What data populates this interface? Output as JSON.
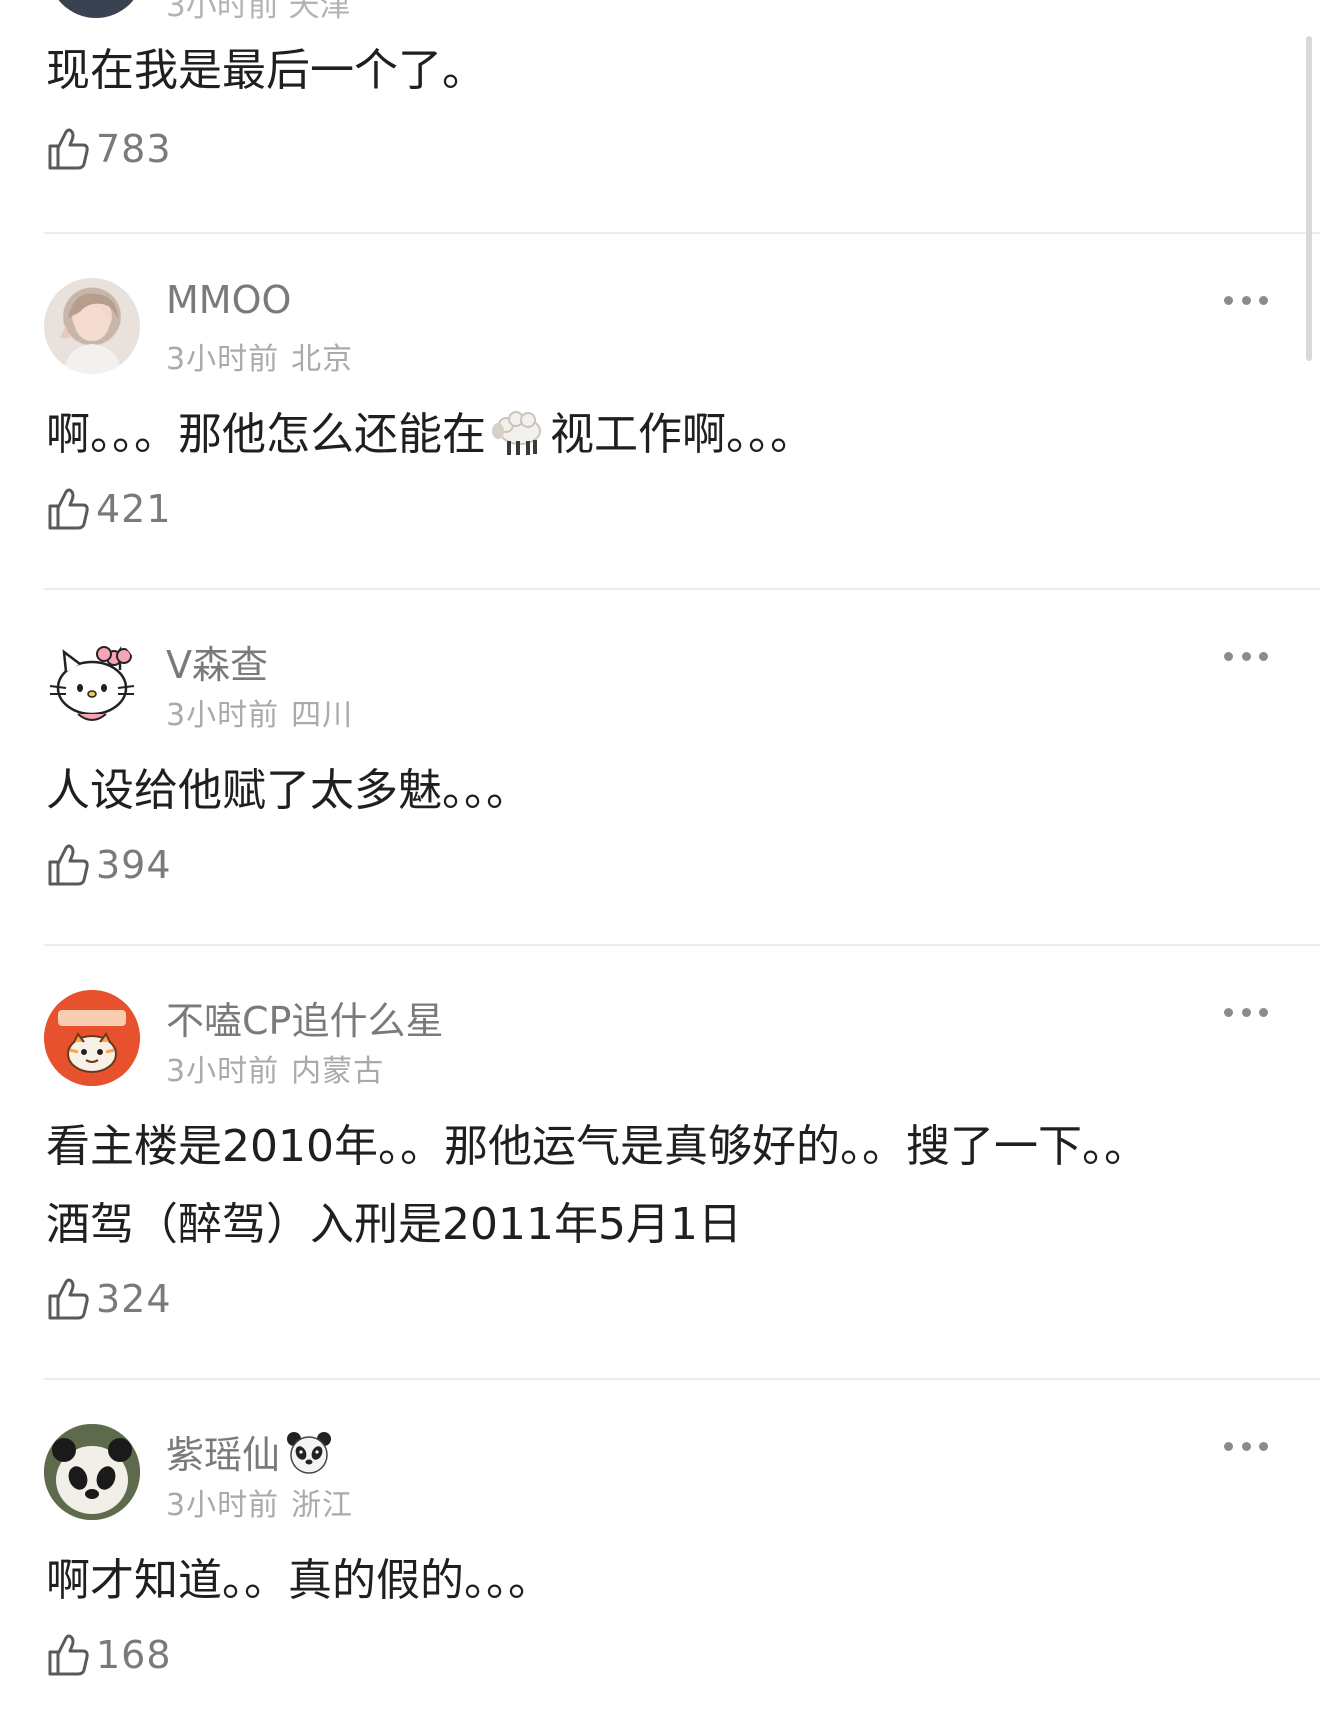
{
  "top_partial": {
    "meta": "3小时前 天津",
    "text": "现在我是最后一个了。",
    "likes": "783"
  },
  "comments": [
    {
      "username": "MMOO",
      "time": "3小时前",
      "location": "北京",
      "text_before": "啊。。。那他怎么还能在",
      "emoji": "sheep-emoji",
      "text_after": "视工作啊。。。",
      "likes": "421"
    },
    {
      "username": "V森查",
      "time": "3小时前",
      "location": "四川",
      "text": "人设给他赋了太多魅。。。",
      "likes": "394"
    },
    {
      "username": "不嗑CP追什么星",
      "time": "3小时前",
      "location": "内蒙古",
      "text_line1": "看主楼是2010年。。那他运气是真够好的。。搜了一下。。",
      "text_line2": "酒驾（醉驾）入刑是2011年5月1日",
      "likes": "324"
    },
    {
      "username": "紫瑶仙",
      "name_emoji": "panda-emoji",
      "time": "3小时前",
      "location": "浙江",
      "text": "啊才知道。。真的假的。。。",
      "likes": "168"
    }
  ],
  "colors": {
    "username": "#7a7a7a",
    "meta": "#aaaaaa",
    "text": "#1f1f1f",
    "divider": "#ececec"
  }
}
